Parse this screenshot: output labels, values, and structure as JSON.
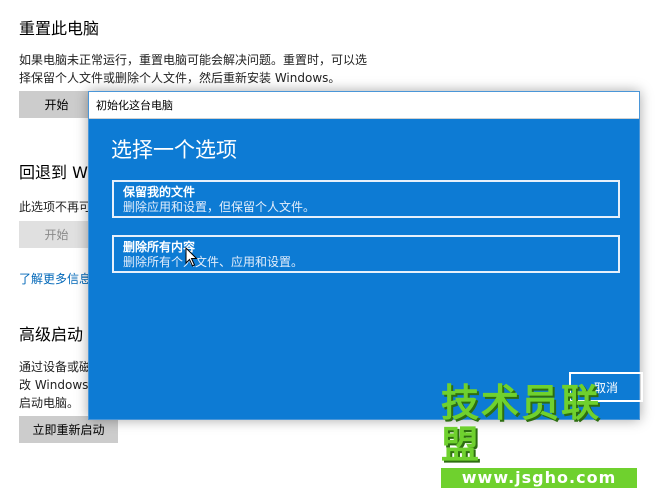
{
  "settings": {
    "reset": {
      "title": "重置此电脑",
      "line1": "如果电脑未正常运行，重置电脑可能会解决问题。重置时，可以选",
      "line2": "择保留个人文件或删除个人文件，然后重新安装 Windows。",
      "button": "开始"
    },
    "goback": {
      "title_partial": "回退到 W",
      "text_partial": "此选项不再可",
      "button": "开始"
    },
    "learn_more_partial": "了解更多信息",
    "advanced": {
      "title": "高级启动",
      "line1_partial": "通过设备或磁",
      "line2_partial": "改 Windows",
      "line3": "启动电脑。",
      "button": "立即重新启动"
    }
  },
  "dialog": {
    "title": "初始化这台电脑",
    "heading": "选择一个选项",
    "options": [
      {
        "title": "保留我的文件",
        "description": "删除应用和设置，但保留个人文件。"
      },
      {
        "title": "删除所有内容",
        "description": "删除所有个人文件、应用和设置。"
      }
    ],
    "cancel": "取消"
  },
  "watermark": {
    "brand": "技术员联盟",
    "url": "www.jsgho.com"
  }
}
